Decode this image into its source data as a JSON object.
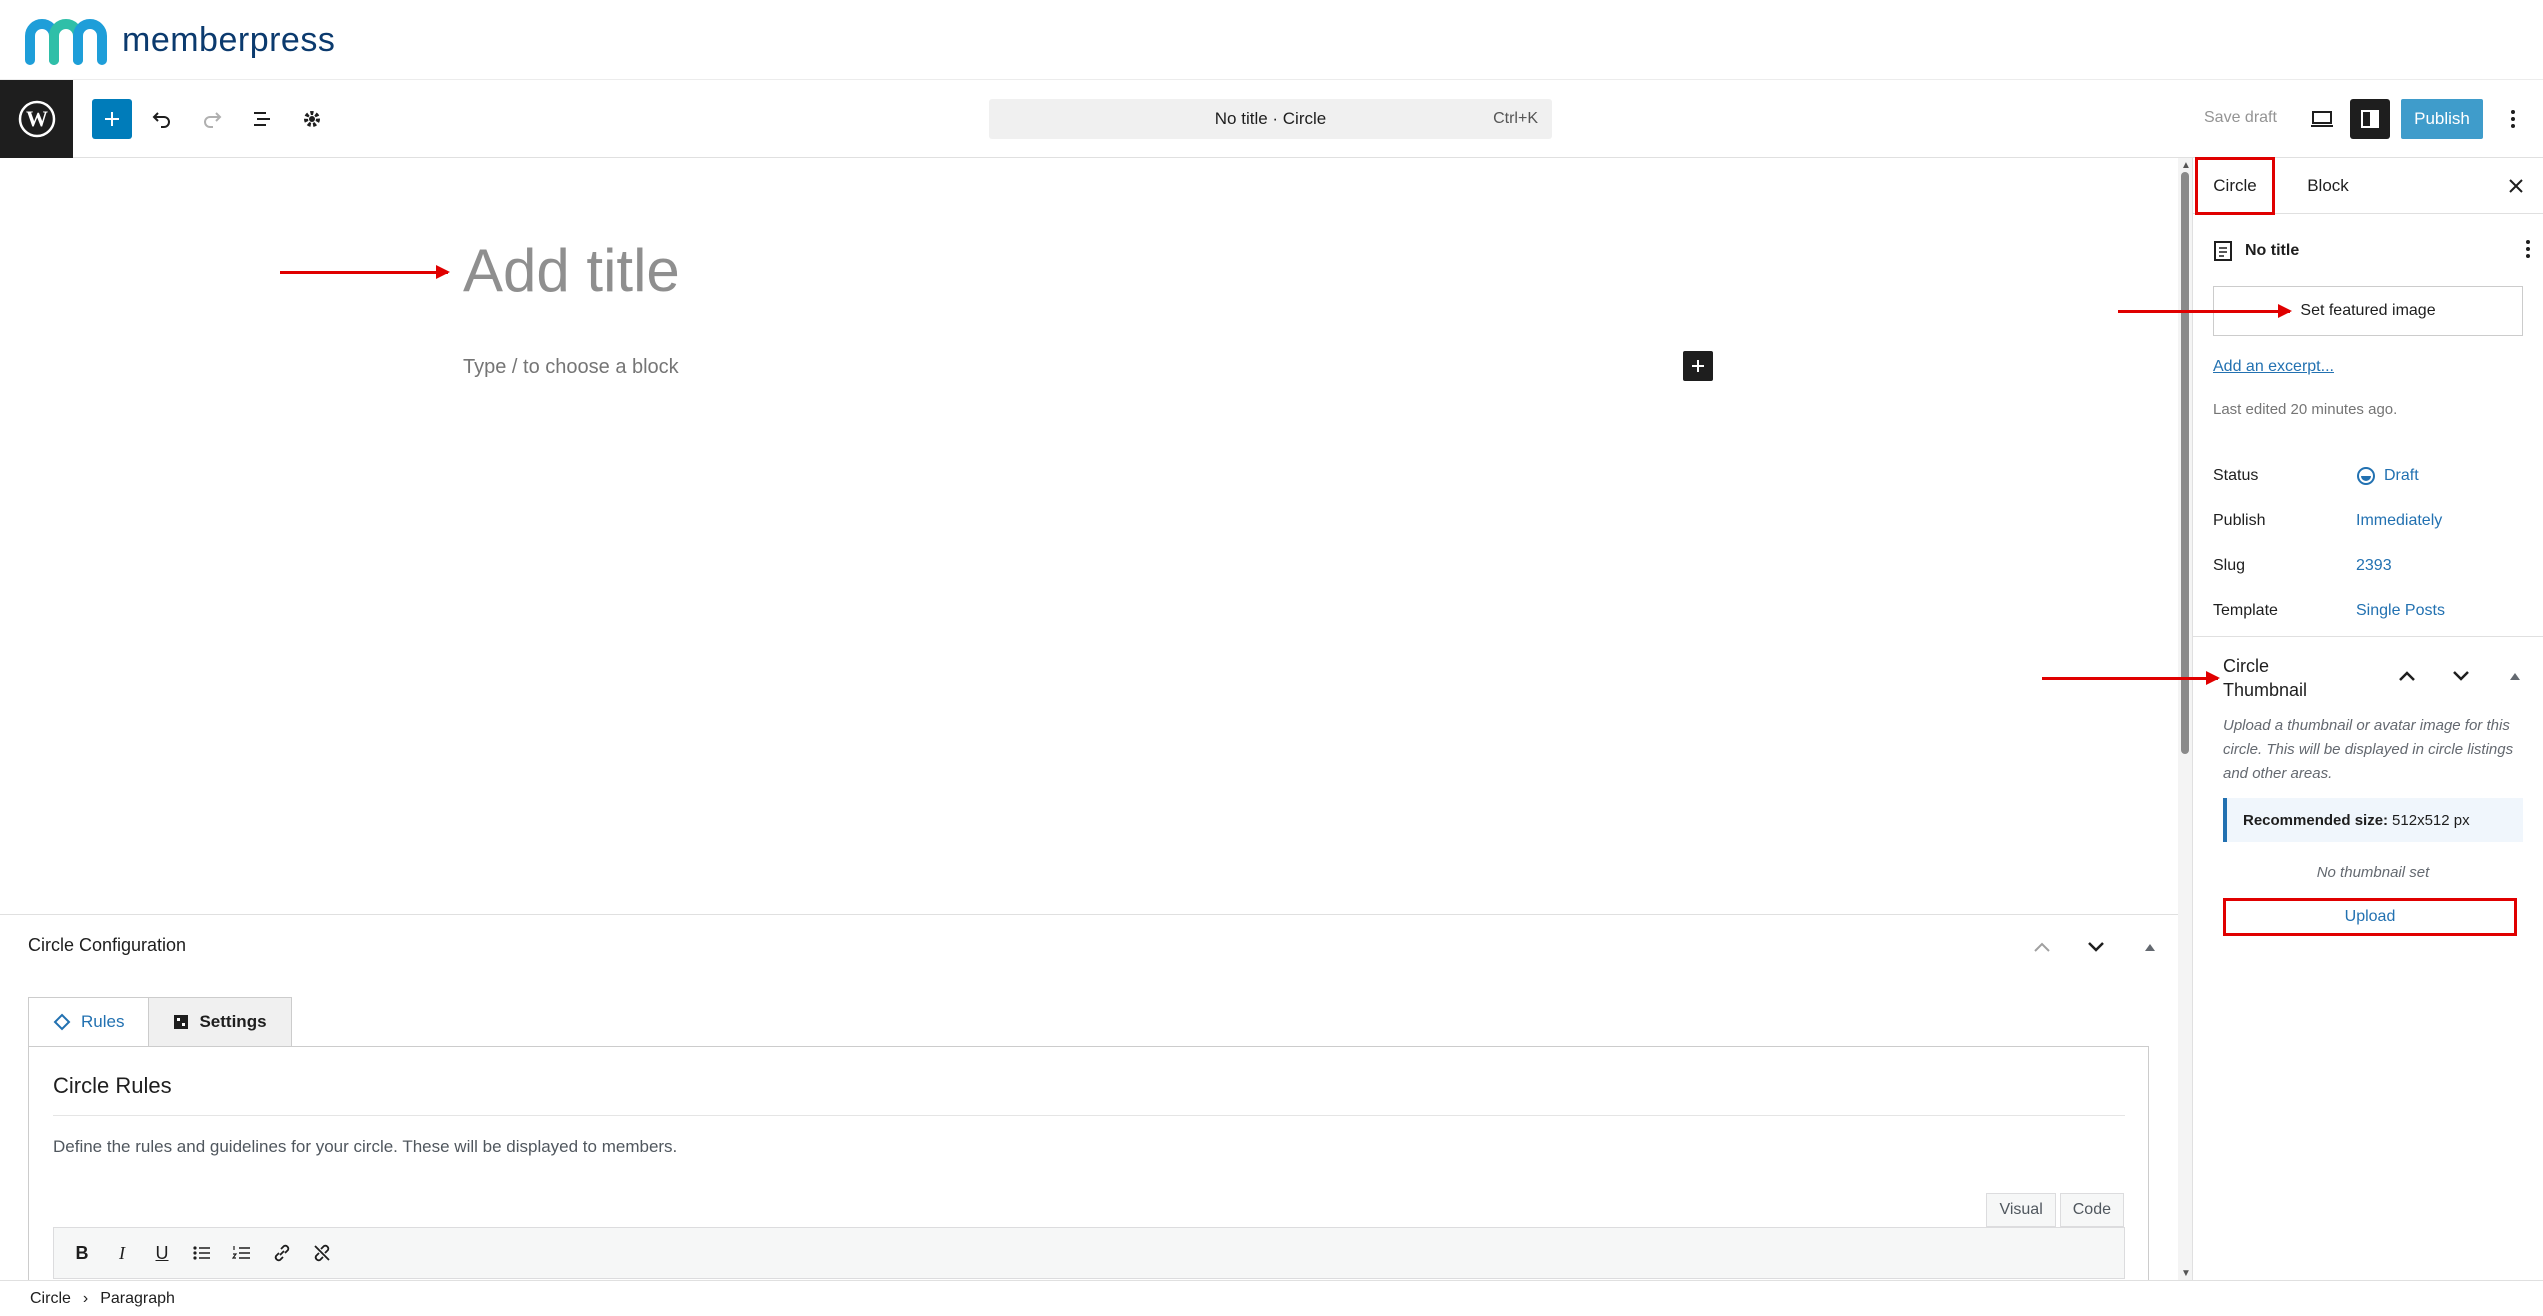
{
  "brand": {
    "name": "memberpress"
  },
  "toolbar": {
    "command_text": "No title · Circle",
    "command_shortcut": "Ctrl+K",
    "save_draft": "Save draft",
    "publish": "Publish"
  },
  "canvas": {
    "title_placeholder": "Add title",
    "block_placeholder": "Type / to choose a block"
  },
  "metabox": {
    "title": "Circle Configuration",
    "tabs": [
      {
        "label": "Rules",
        "icon": "tag-icon"
      },
      {
        "label": "Settings",
        "icon": "grid-icon"
      }
    ],
    "rules_title": "Circle Rules",
    "rules_desc": "Define the rules and guidelines for your circle. These will be displayed to members.",
    "editor_tabs": [
      "Visual",
      "Code"
    ]
  },
  "footer": {
    "breadcrumb": [
      "Circle",
      "Paragraph"
    ]
  },
  "sidebar": {
    "tabs": [
      "Circle",
      "Block"
    ],
    "doc_title": "No title",
    "featured_image": "Set featured image",
    "excerpt": "Add an excerpt...",
    "last_edited": "Last edited 20 minutes ago.",
    "meta": [
      {
        "label": "Status",
        "value": "Draft"
      },
      {
        "label": "Publish",
        "value": "Immediately"
      },
      {
        "label": "Slug",
        "value": "2393"
      },
      {
        "label": "Template",
        "value": "Single Posts"
      }
    ],
    "thumbnail": {
      "title": "Circle Thumbnail",
      "description": "Upload a thumbnail or avatar image for this circle. This will be displayed in circle listings and other areas.",
      "recommended_label": "Recommended size:",
      "recommended_value": "512x512 px",
      "none_text": "No thumbnail set",
      "upload": "Upload"
    }
  },
  "colors": {
    "accent": "#007cba",
    "annotation": "#e00000",
    "link": "#2271b1"
  }
}
